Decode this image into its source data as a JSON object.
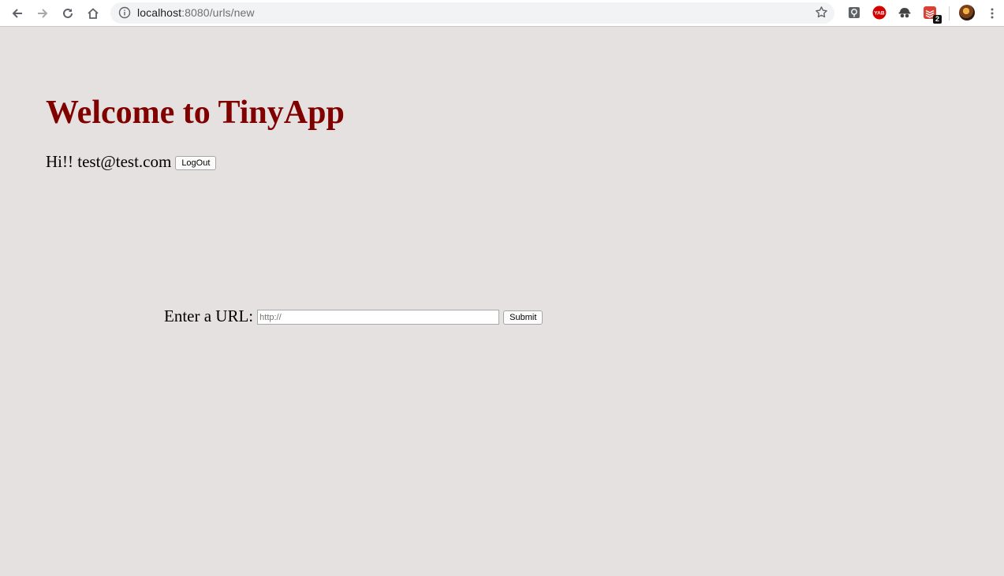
{
  "browser": {
    "url_host": "localhost",
    "url_path": ":8080/urls/new",
    "extensions": [
      {
        "name": "pin-extension-icon"
      },
      {
        "name": "yab-extension-icon",
        "label": "YAB",
        "color": "#d40000"
      },
      {
        "name": "spy-extension-icon"
      },
      {
        "name": "todoist-extension-icon",
        "badge": "2",
        "color": "#db4035"
      }
    ]
  },
  "page": {
    "title": "Welcome to TinyApp",
    "greeting": "Hi!! test@test.com",
    "logout_label": "LogOut",
    "url_form": {
      "label": "Enter a URL:",
      "placeholder": "http://",
      "submit_label": "Submit"
    }
  },
  "colors": {
    "background": "#e6e1e1",
    "title": "#800000"
  }
}
